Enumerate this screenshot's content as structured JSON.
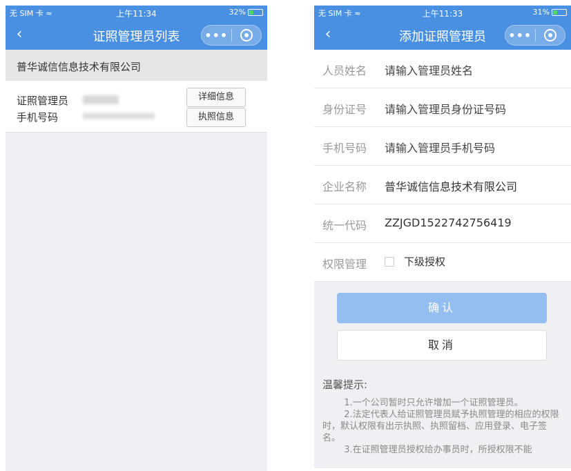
{
  "left": {
    "status": {
      "carrier": "无 SIM 卡 ≈",
      "time": "上午11:34",
      "battery": "32%",
      "battery_level": 0.32
    },
    "title": "证照管理员列表",
    "company": "普华诚信信息技术有限公司",
    "card": {
      "manager_label": "证照管理员",
      "phone_label": "手机号码",
      "detail_button": "详细信息",
      "license_button": "执照信息"
    }
  },
  "right": {
    "status": {
      "carrier": "无 SIM 卡 ≈",
      "time": "上午11:33",
      "battery": "31%",
      "battery_level": 0.31
    },
    "title": "添加证照管理员",
    "fields": {
      "name": {
        "label": "人员姓名",
        "placeholder": "请输入管理员姓名"
      },
      "id": {
        "label": "身份证号",
        "placeholder": "请输入管理员身份证号码"
      },
      "phone": {
        "label": "手机号码",
        "placeholder": "请输入管理员手机号码"
      },
      "company": {
        "label": "企业名称",
        "value": "普华诚信信息技术有限公司"
      },
      "code": {
        "label": "统一代码",
        "value": "ZZJGD1522742756419"
      },
      "permission": {
        "label": "权限管理",
        "checkbox_label": "下级授权",
        "checked": false
      }
    },
    "confirm_button": "确认",
    "cancel_button": "取消",
    "tips": {
      "title": "温馨提示:",
      "items": [
        "1.一个公司暂时只允许增加一个证照管理员。",
        "2.法定代表人给证照管理员赋予执照管理的相应的权限时，默认权限有出示执照、执照留档、应用登录、电子签名。",
        "3.在证照管理员授权给办事员时，所授权限不能"
      ]
    }
  },
  "colors": {
    "header": "#4a90e2",
    "confirm": "#94bdf0",
    "background": "#efeff4"
  }
}
